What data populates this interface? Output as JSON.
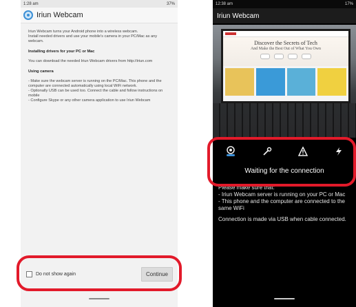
{
  "colors": {
    "highlight": "#e21a2a",
    "accent": "#3b8fd6",
    "pill_left": "#888888",
    "pill_right": "#cccccc"
  },
  "left": {
    "status_time": "1:28 am",
    "status_right": "37%",
    "title": "Iriun Webcam",
    "paragraphs": [
      "Iriun Webcam turns your Android phone into a wireless webcam.\nInstall needed drivers and use your mobile's camera in your PC/Mac as any webcam."
    ],
    "heading_drivers": "Installing drivers for your PC or Mac",
    "drivers_text": "You can download the needed Iriun Webcam drivers from http://iriun.com",
    "heading_camera": "Using camera",
    "camera_text": "- Make sure the webcam server is running on the PC/Mac. This phone and the computer are connected automatically using local WiFi network.\n- Optionally USB can be used too. Connect the cable and follow instructions on mobile\n- Configure Skype or any other camera application to use Iriun Webcam",
    "checkbox_label": "Do not show again",
    "continue_label": "Continue"
  },
  "right": {
    "status_time": "12:38 am",
    "status_right": "17%",
    "title": "Iriun Webcam",
    "web_title": "Discover the Secrets of Tech",
    "web_subtitle": "And Make the Best Out of What You Own",
    "icons": [
      "camera-icon",
      "wrench-icon",
      "warning-icon",
      "flash-icon"
    ],
    "waiting": "Waiting for the connection",
    "info_1": "Please make sure that:\n- Iriun Webcam server is running on your PC or Mac\n- This phone and the computer are connected to the same WiFi",
    "info_2": "Connection is made via USB when cable connected."
  }
}
